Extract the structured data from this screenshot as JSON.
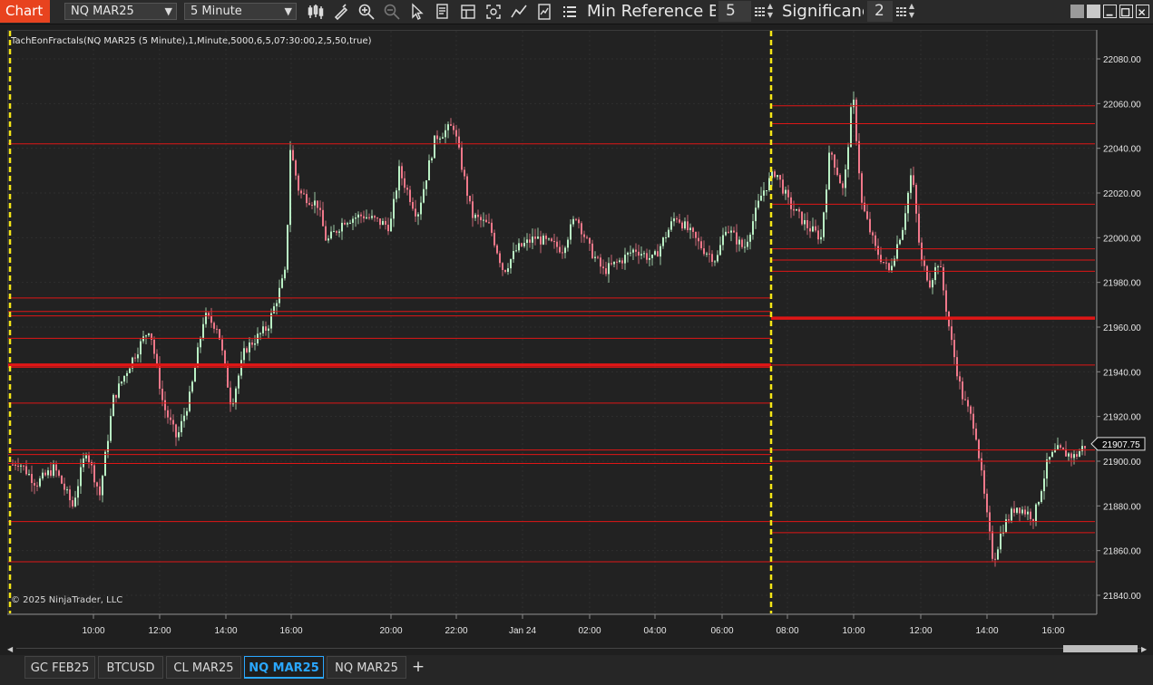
{
  "toolbar": {
    "chart_tab": "Chart",
    "instrument": "NQ MAR25",
    "interval": "5 Minute",
    "param1_label": "Min Reference Ba",
    "param1_value": "5",
    "param2_label": "Significanc",
    "param2_value": "2",
    "icons": [
      "bar-chart-style-icon",
      "draw-pencil-icon",
      "zoom-in-icon",
      "zoom-out-icon",
      "pointer-icon",
      "properties-icon",
      "data-box-icon",
      "crosshair-icon",
      "indicators-icon",
      "strategies-icon",
      "list-icon"
    ]
  },
  "chart": {
    "indicator_label": "TachEonFractals(NQ MAR25 (5 Minute),1,Minute,5000,6,5,07:30:00,2,5,50,true)",
    "copyright": "© 2025 NinjaTrader, LLC",
    "current_price": "21907.75",
    "price_ticks": [
      "22080.00",
      "22060.00",
      "22040.00",
      "22020.00",
      "22000.00",
      "21980.00",
      "21960.00",
      "21940.00",
      "21920.00",
      "21900.00",
      "21880.00",
      "21860.00",
      "21840.00"
    ],
    "time_ticks": [
      "10:00",
      "12:00",
      "14:00",
      "16:00",
      "20:00",
      "22:00",
      "Jan 24",
      "02:00",
      "04:00",
      "06:00",
      "08:00",
      "10:00",
      "12:00",
      "14:00",
      "16:00"
    ],
    "colors": {
      "up": "#b9f0c4",
      "down": "#f0788a",
      "level": "#e01616",
      "session": "#f5e616",
      "price_tag": "#111111"
    }
  },
  "chart_data": {
    "type": "candlestick",
    "ylim": [
      21835,
      22095
    ],
    "session_separators": [
      "~01/23 07:30",
      "~01/24 07:30"
    ],
    "levels_session1": [
      21973,
      21967,
      21965,
      21955,
      21943,
      21942,
      21926,
      22042,
      21905,
      21903,
      21899,
      21873,
      21855
    ],
    "levels_session2": [
      22059,
      22051,
      22042,
      22015,
      21995,
      21990,
      21985,
      21964,
      21943,
      21905,
      21900,
      21873,
      21868,
      21855
    ],
    "close_path": [
      [
        0,
        21895
      ],
      [
        20,
        21900
      ],
      [
        40,
        21890
      ],
      [
        60,
        21897
      ],
      [
        80,
        21880
      ],
      [
        95,
        21905
      ],
      [
        110,
        21885
      ],
      [
        125,
        21928
      ],
      [
        145,
        21945
      ],
      [
        165,
        21960
      ],
      [
        180,
        21925
      ],
      [
        195,
        21910
      ],
      [
        210,
        21930
      ],
      [
        225,
        21965
      ],
      [
        240,
        21960
      ],
      [
        255,
        21925
      ],
      [
        270,
        21950
      ],
      [
        295,
        21960
      ],
      [
        315,
        21985
      ],
      [
        320,
        22040
      ],
      [
        330,
        22020
      ],
      [
        350,
        22015
      ],
      [
        360,
        21998
      ],
      [
        380,
        22008
      ],
      [
        400,
        22010
      ],
      [
        430,
        22005
      ],
      [
        440,
        22030
      ],
      [
        460,
        22010
      ],
      [
        480,
        22045
      ],
      [
        500,
        22050
      ],
      [
        520,
        22010
      ],
      [
        540,
        22005
      ],
      [
        555,
        21985
      ],
      [
        570,
        21995
      ],
      [
        590,
        22000
      ],
      [
        620,
        21995
      ],
      [
        635,
        22010
      ],
      [
        650,
        21995
      ],
      [
        665,
        21985
      ],
      [
        685,
        21990
      ],
      [
        700,
        21995
      ],
      [
        720,
        21990
      ],
      [
        745,
        22010
      ],
      [
        775,
        21995
      ],
      [
        790,
        21990
      ],
      [
        800,
        22005
      ],
      [
        820,
        21995
      ],
      [
        840,
        22020
      ],
      [
        855,
        22030
      ],
      [
        870,
        22015
      ],
      [
        890,
        22005
      ],
      [
        905,
        22000
      ],
      [
        915,
        22040
      ],
      [
        930,
        22020
      ],
      [
        940,
        22065
      ],
      [
        950,
        22015
      ],
      [
        965,
        21995
      ],
      [
        980,
        21985
      ],
      [
        995,
        22005
      ],
      [
        1005,
        22030
      ],
      [
        1015,
        21990
      ],
      [
        1025,
        21980
      ],
      [
        1035,
        21990
      ],
      [
        1048,
        21955
      ],
      [
        1060,
        21930
      ],
      [
        1075,
        21915
      ],
      [
        1088,
        21875
      ],
      [
        1095,
        21855
      ],
      [
        1105,
        21870
      ],
      [
        1120,
        21880
      ],
      [
        1140,
        21875
      ],
      [
        1155,
        21900
      ],
      [
        1165,
        21905
      ],
      [
        1185,
        21902
      ],
      [
        1195,
        21907
      ]
    ]
  },
  "bottom_tabs": [
    {
      "label": "GC FEB25",
      "active": false
    },
    {
      "label": "BTCUSD",
      "active": false
    },
    {
      "label": "CL MAR25",
      "active": false
    },
    {
      "label": "NQ MAR25",
      "active": true
    },
    {
      "label": "NQ MAR25",
      "active": false
    }
  ]
}
